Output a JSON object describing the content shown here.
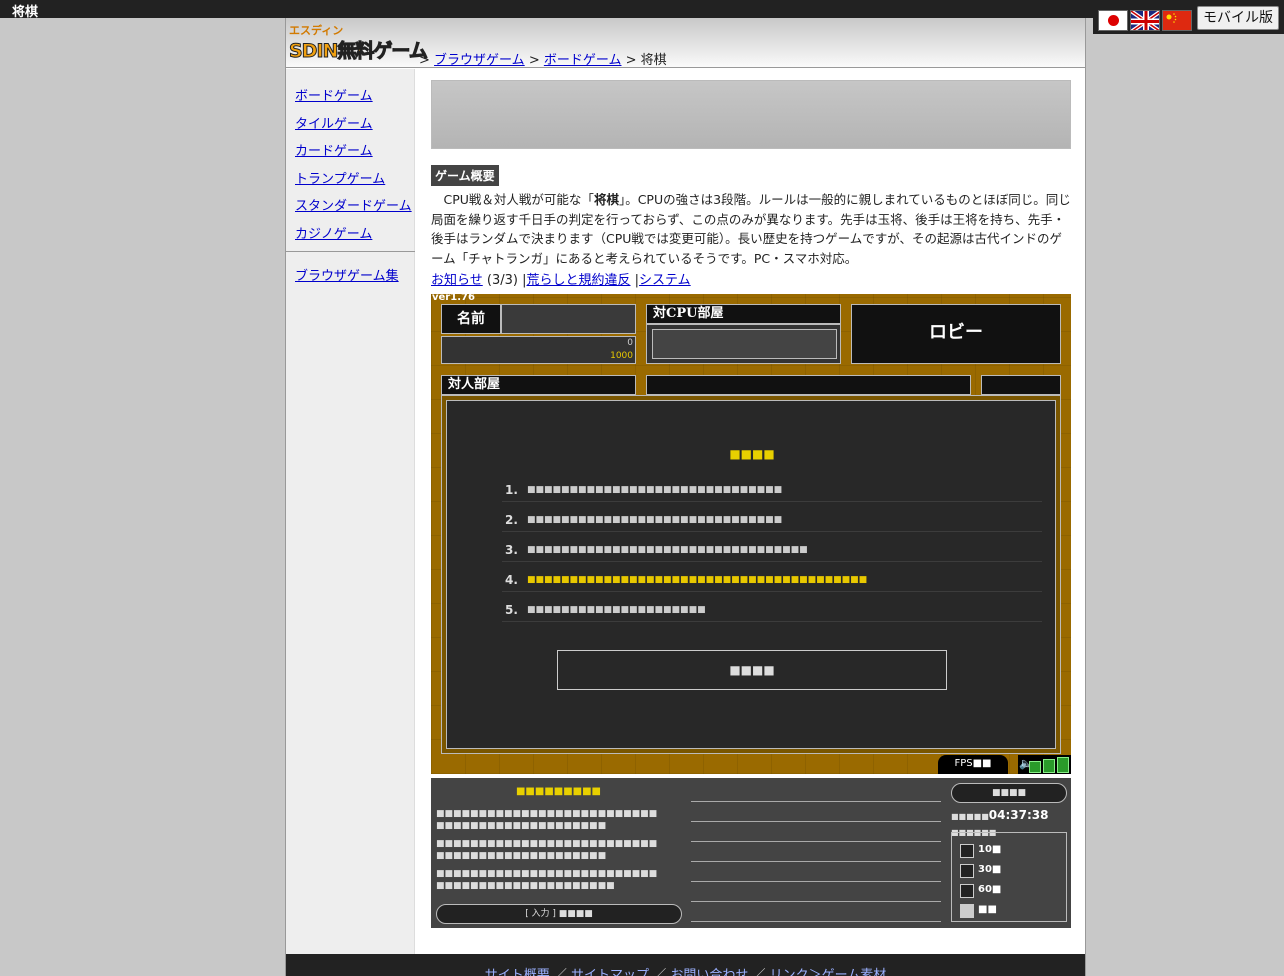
{
  "page": {
    "title": "将棋"
  },
  "lang": {
    "mobile_label": "モバイル版"
  },
  "logo": {
    "small": "エスディン",
    "main": "SDIN無料ゲーム"
  },
  "breadcrumb": {
    "sep1": ">",
    "item1": "ブラウザゲーム",
    "sep2": ">",
    "item2": "ボードゲーム",
    "sep3": ">",
    "current": "将棋"
  },
  "sidebar": {
    "items": [
      {
        "label": "ボードゲーム"
      },
      {
        "label": "タイルゲーム"
      },
      {
        "label": "カードゲーム"
      },
      {
        "label": "トランプゲーム"
      },
      {
        "label": "スタンダードゲーム"
      },
      {
        "label": "カジノゲーム"
      }
    ],
    "extra": "ブラウザゲーム集"
  },
  "overview": {
    "title": "ゲーム概要",
    "text_before": "CPU戦＆対人戦が可能な「",
    "bold": "将棋",
    "text_after": "」。CPUの強さは3段階。ルールは一般的に親しまれているものとほぼ同じ。同じ局面を繰り返す千日手の判定を行っておらず、この点のみが異なります。先手は玉将、後手は王将を持ち、先手・後手はランダムで決まります（CPU戦では変更可能）。長い歴史を持つゲームですが、その起源は古代インドのゲーム「チャトランガ」にあると考えられているそうです。PC・スマホ対応。"
  },
  "info_links": {
    "news": "お知らせ",
    "news_count": "(3/3)",
    "sep1": "|",
    "rules": "荒らしと規約違反",
    "sep2": "|",
    "system": "システム"
  },
  "game": {
    "version": "ver1.76",
    "name_label": "名前",
    "stat1_value": "0",
    "stat2_value": "1000",
    "cpu_label": "対CPU部屋",
    "lobby_label": "ロビー",
    "pvp_label": "対人部屋",
    "fps_label": "FPS",
    "volume_level": 3
  },
  "chat": {
    "input_label": "[ 入力 ]"
  },
  "clock": {
    "time": "04:37:38"
  },
  "interval": {
    "options": [
      {
        "label": "10",
        "checked": false
      },
      {
        "label": "30",
        "checked": false
      },
      {
        "label": "60",
        "checked": false
      },
      {
        "label": "",
        "checked": true
      }
    ]
  },
  "footer": {
    "link1": "サイト概要",
    "sep": "／",
    "link2": "サイトマップ",
    "link3": "お問い合わせ",
    "link4": "リンク＞ゲーム素材"
  }
}
